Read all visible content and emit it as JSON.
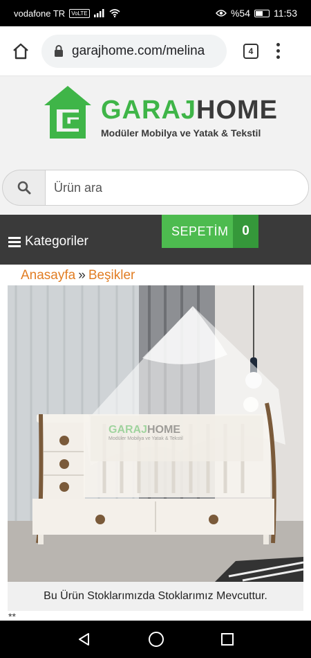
{
  "status_bar": {
    "carrier": "vodafone TR",
    "volte": "VoLTE",
    "battery_percent": "%54",
    "battery_level": 0.54,
    "time": "11:53"
  },
  "browser": {
    "url": "garajhome.com/melina",
    "tab_count": "4"
  },
  "header": {
    "logo_word_green": "GARAJ",
    "logo_word_dark": "HOME",
    "logo_tagline": "Modüler Mobilya ve Yatak & Tekstil",
    "search_placeholder": "Ürün ara"
  },
  "nav": {
    "categories_label": "Kategoriler",
    "cart_label": "SEPETİM",
    "cart_count": "0"
  },
  "breadcrumb": {
    "home": "Anasayfa",
    "separator": "»",
    "current": "Beşikler"
  },
  "product": {
    "image_watermark_green": "GARAJ",
    "image_watermark_dark": "HOME",
    "image_watermark_tagline": "Modüler Mobilya ve Yatak & Tekstil",
    "stock_note": "Bu Ürün Stoklarımızda Stoklarımız Mevcuttur.",
    "extra": "**"
  },
  "colors": {
    "brand_green": "#3fb548",
    "accent_orange": "#e17d23",
    "nav_dark": "#3a3a3a"
  }
}
